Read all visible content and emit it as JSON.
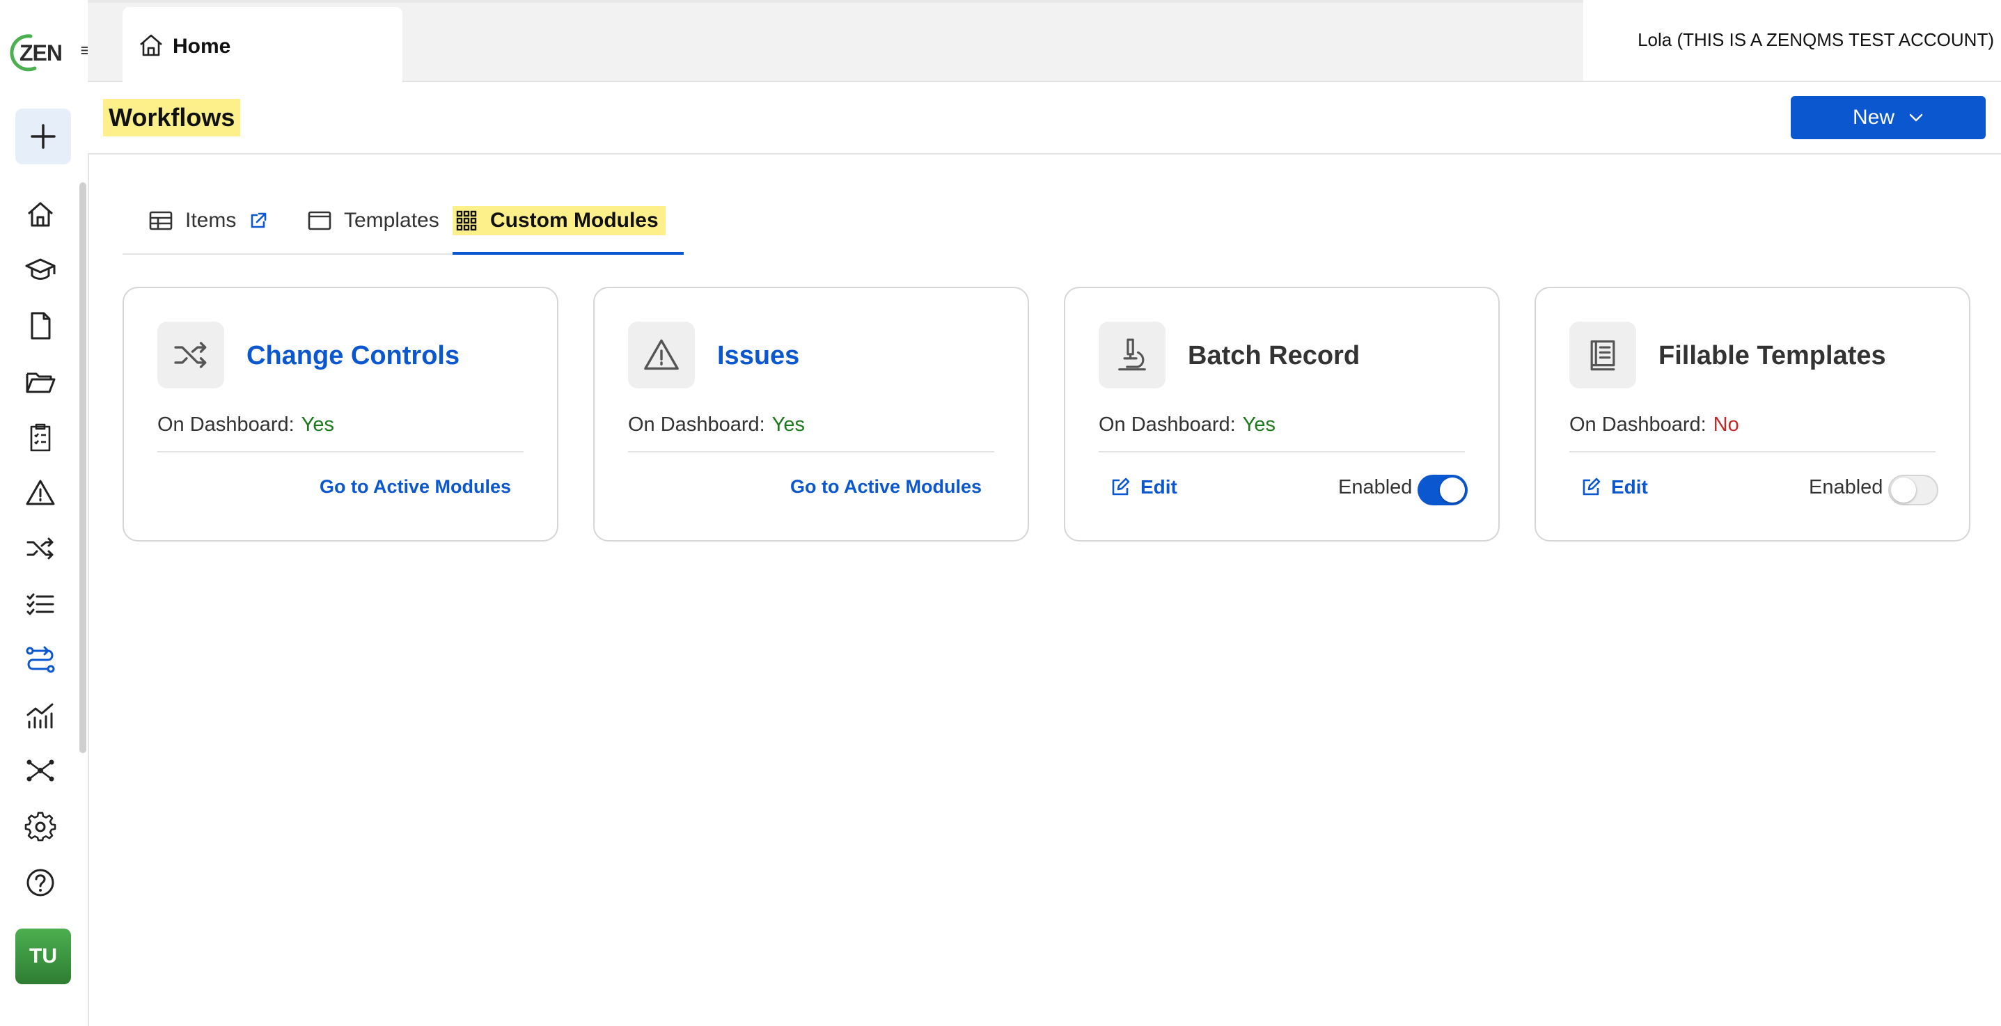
{
  "logo": {
    "text": "ZEN"
  },
  "topbar": {
    "home_tab_label": "Home",
    "account_label": "Lola (THIS IS A ZENQMS TEST ACCOUNT)"
  },
  "header": {
    "page_title": "Workflows",
    "new_button_label": "New"
  },
  "tabs": [
    {
      "label": "Items",
      "icon": "table-icon"
    },
    {
      "label": "Templates",
      "icon": "window-icon"
    },
    {
      "label": "Custom Modules",
      "icon": "grid-icon",
      "active": true
    }
  ],
  "cards": [
    {
      "title": "Change Controls",
      "icon": "shuffle-icon",
      "dashboard_label": "On Dashboard:",
      "dashboard_value": "Yes",
      "link_label": "Go to Active Modules"
    },
    {
      "title": "Issues",
      "icon": "warning-icon",
      "dashboard_label": "On Dashboard:",
      "dashboard_value": "Yes",
      "link_label": "Go to Active Modules"
    },
    {
      "title": "Batch Record",
      "icon": "microscope-icon",
      "dashboard_label": "On Dashboard:",
      "dashboard_value": "Yes",
      "edit_label": "Edit",
      "enabled_label": "Enabled",
      "enabled": true
    },
    {
      "title": "Fillable Templates",
      "icon": "book-icon",
      "dashboard_label": "On Dashboard:",
      "dashboard_value": "No",
      "edit_label": "Edit",
      "enabled_label": "Enabled",
      "enabled": false
    }
  ],
  "user": {
    "initials": "TU"
  },
  "colors": {
    "primary": "#0b57d0",
    "highlight": "#fdf08a",
    "yes": "#1b7a1b",
    "no": "#c62828",
    "avatar": "#3e9b43"
  }
}
